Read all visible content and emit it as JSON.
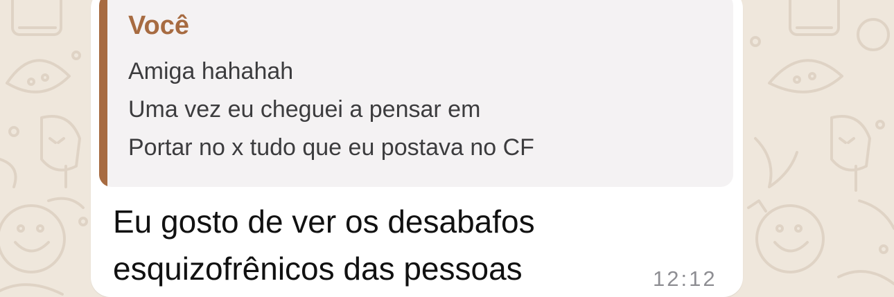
{
  "colors": {
    "wallpaper": "#efe7dc",
    "doodle": "#dfd5c8",
    "bubble": "#ffffff",
    "quote_background": "#f4f2f3",
    "quote_accent": "#a76b41",
    "timestamp": "#8e8e93"
  },
  "message": {
    "quoted_reply": {
      "author": "Você",
      "lines": [
        "Amiga hahahah",
        "Uma vez eu cheguei a pensar em",
        "Portar no x tudo que eu postava no CF"
      ]
    },
    "text_lines": [
      "Eu gosto de ver os desabafos",
      "esquizofrênicos das pessoas"
    ],
    "time": "12:12"
  }
}
